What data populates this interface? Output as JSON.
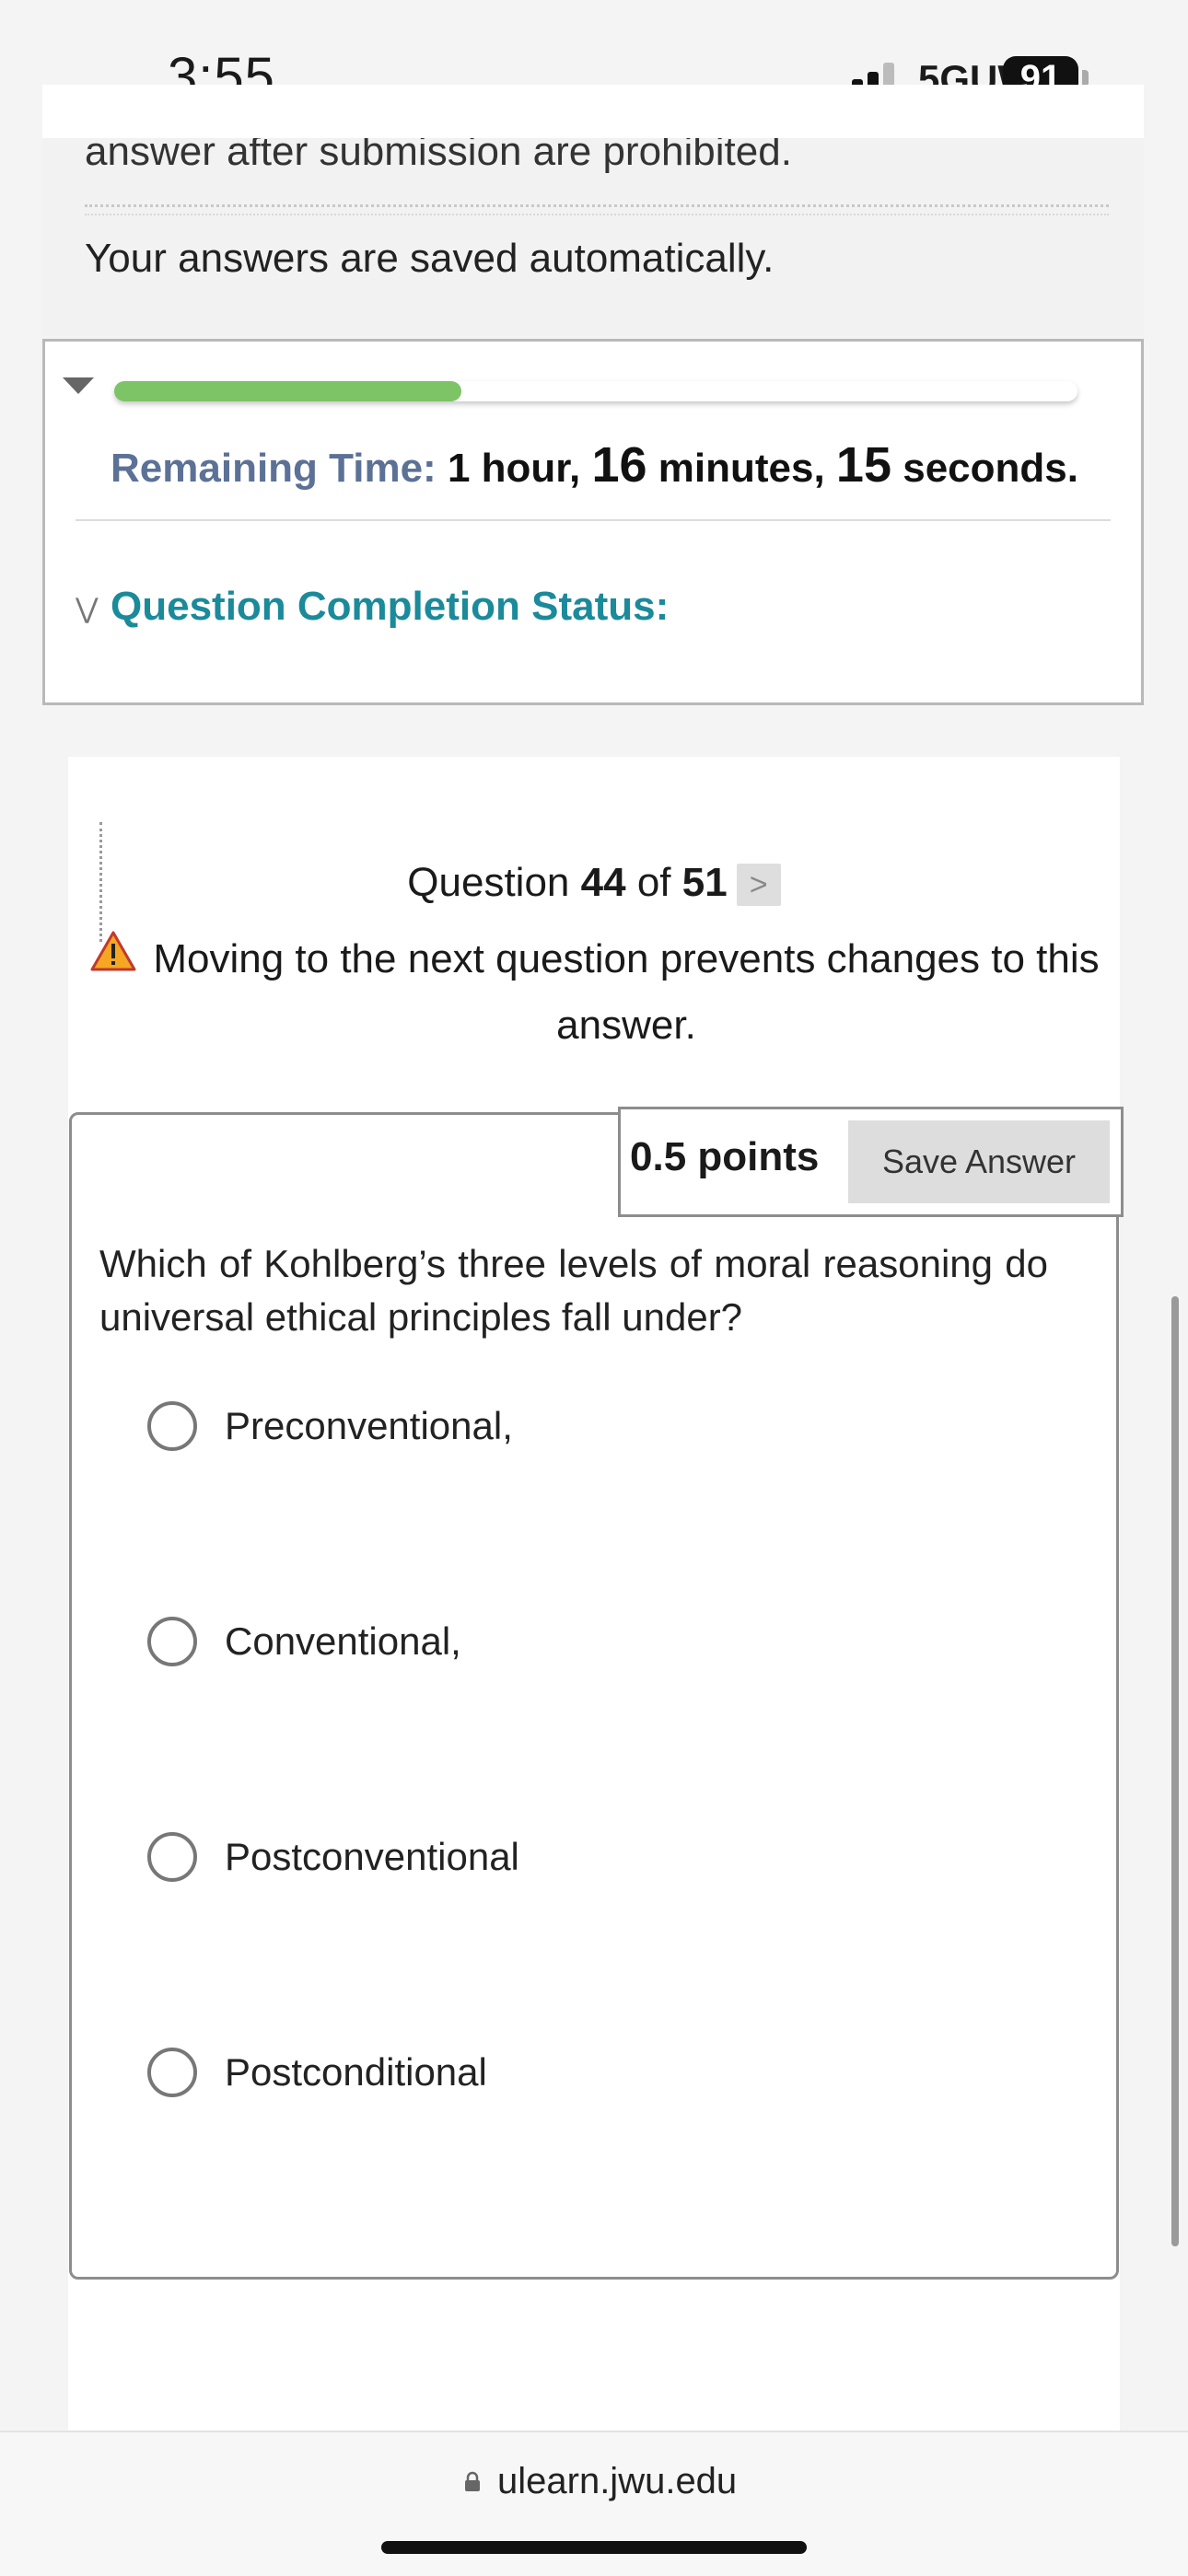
{
  "status_bar": {
    "time": "3:55",
    "network": "5GUW",
    "battery": "91"
  },
  "instructions": {
    "truncated_line": "answer after submission are prohibited.",
    "autosave_note": "Your answers are saved automatically."
  },
  "timer": {
    "progress_fraction": 0.36,
    "label": "Remaining Time:",
    "hours_value": "1",
    "hours_unit": "hour,",
    "minutes_value": "16",
    "minutes_unit": "minutes,",
    "seconds_value": "15",
    "seconds_unit": "seconds.",
    "completion_status_label": "Question Completion Status:"
  },
  "question_nav": {
    "prefix": "Question",
    "current": "44",
    "of": "of",
    "total": "51",
    "next_glyph": ">",
    "warning": "Moving to the next question prevents changes to this answer."
  },
  "question": {
    "points": "0.5 points",
    "save_label": "Save Answer",
    "text": "Which of Kohlberg’s three levels of moral reasoning do universal ethical principles fall under?",
    "options": [
      {
        "label": "Preconventional,"
      },
      {
        "label": "Conventional,"
      },
      {
        "label": "Postconventional"
      },
      {
        "label": "Postconditional"
      }
    ]
  },
  "browser": {
    "url": "ulearn.jwu.edu"
  },
  "colors": {
    "progress": "#7cc465",
    "remaining_label": "#5c7196",
    "completion_status": "#1b8a9a"
  }
}
